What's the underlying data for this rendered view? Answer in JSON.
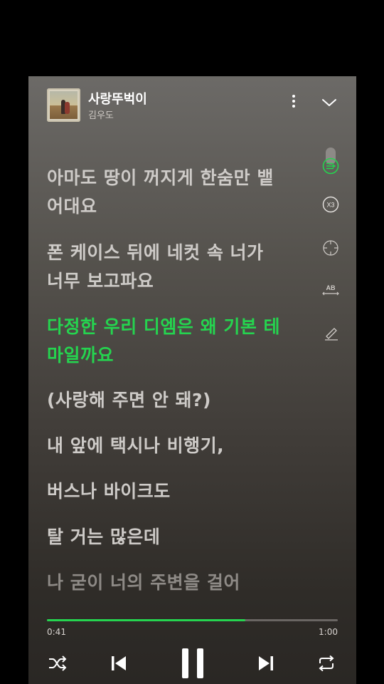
{
  "song": {
    "title": "사랑뚜벅이",
    "artist": "김우도"
  },
  "lyrics": [
    {
      "line1": "아마도 땅이 꺼지게 한숨만 뱉",
      "line2": "어대요"
    },
    {
      "line1": "폰 케이스 뒤에 네컷 속 너가",
      "line2": "너무 보고파요"
    },
    {
      "line1": "다정한 우리 디엠은 왜 기본 테",
      "line2": "마일까요"
    },
    {
      "line1": "(사랑해 주면 안 돼?)"
    },
    {
      "line1": "내 앞에 택시나 비행기,"
    },
    {
      "line1": "버스나 바이크도"
    },
    {
      "line1": "탈 거는 많은데"
    },
    {
      "line1": "나 굳이 너의 주변을 걸어"
    }
  ],
  "active_lyric_index": 2,
  "side_tools": {
    "speed_label": "X3",
    "font_label": "AB"
  },
  "progress": {
    "current": "0:41",
    "duration": "1:00",
    "fraction": 0.683
  },
  "colors": {
    "accent": "#25d44f",
    "background": "#000000"
  },
  "icons": [
    "more-icon",
    "chevron-down-icon",
    "lyrics-sync-icon",
    "speed-icon",
    "focus-icon",
    "font-size-icon",
    "highlight-pen-icon",
    "shuffle-icon",
    "previous-icon",
    "pause-icon",
    "next-icon",
    "repeat-icon"
  ]
}
